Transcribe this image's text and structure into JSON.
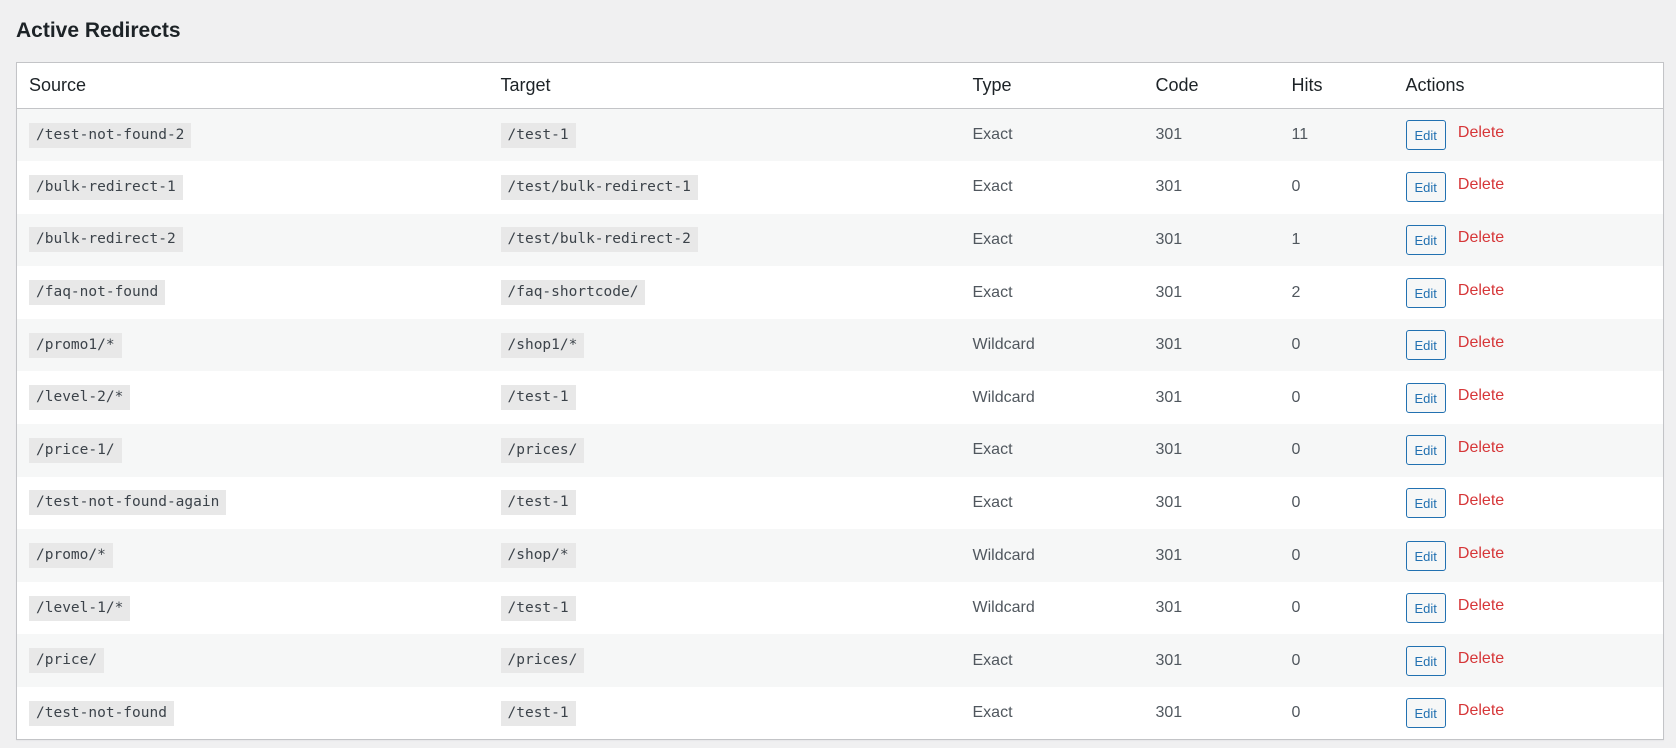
{
  "page": {
    "title": "Active Redirects"
  },
  "table": {
    "headers": {
      "source": "Source",
      "target": "Target",
      "type": "Type",
      "code": "Code",
      "hits": "Hits",
      "actions": "Actions"
    },
    "edit_label": "Edit",
    "delete_label": "Delete",
    "rows": [
      {
        "source": "/test-not-found-2",
        "target": "/test-1",
        "type": "Exact",
        "code": "301",
        "hits": "11"
      },
      {
        "source": "/bulk-redirect-1",
        "target": "/test/bulk-redirect-1",
        "type": "Exact",
        "code": "301",
        "hits": "0"
      },
      {
        "source": "/bulk-redirect-2",
        "target": "/test/bulk-redirect-2",
        "type": "Exact",
        "code": "301",
        "hits": "1"
      },
      {
        "source": "/faq-not-found",
        "target": "/faq-shortcode/",
        "type": "Exact",
        "code": "301",
        "hits": "2"
      },
      {
        "source": "/promo1/*",
        "target": "/shop1/*",
        "type": "Wildcard",
        "code": "301",
        "hits": "0"
      },
      {
        "source": "/level-2/*",
        "target": "/test-1",
        "type": "Wildcard",
        "code": "301",
        "hits": "0"
      },
      {
        "source": "/price-1/",
        "target": "/prices/",
        "type": "Exact",
        "code": "301",
        "hits": "0"
      },
      {
        "source": "/test-not-found-again",
        "target": "/test-1",
        "type": "Exact",
        "code": "301",
        "hits": "0"
      },
      {
        "source": "/promo/*",
        "target": "/shop/*",
        "type": "Wildcard",
        "code": "301",
        "hits": "0"
      },
      {
        "source": "/level-1/*",
        "target": "/test-1",
        "type": "Wildcard",
        "code": "301",
        "hits": "0"
      },
      {
        "source": "/price/",
        "target": "/prices/",
        "type": "Exact",
        "code": "301",
        "hits": "0"
      },
      {
        "source": "/test-not-found",
        "target": "/test-1",
        "type": "Exact",
        "code": "301",
        "hits": "0"
      }
    ]
  },
  "colors": {
    "page_background": "#f0f0f1",
    "edit_button": "#2271b1",
    "delete_link": "#d63638"
  }
}
